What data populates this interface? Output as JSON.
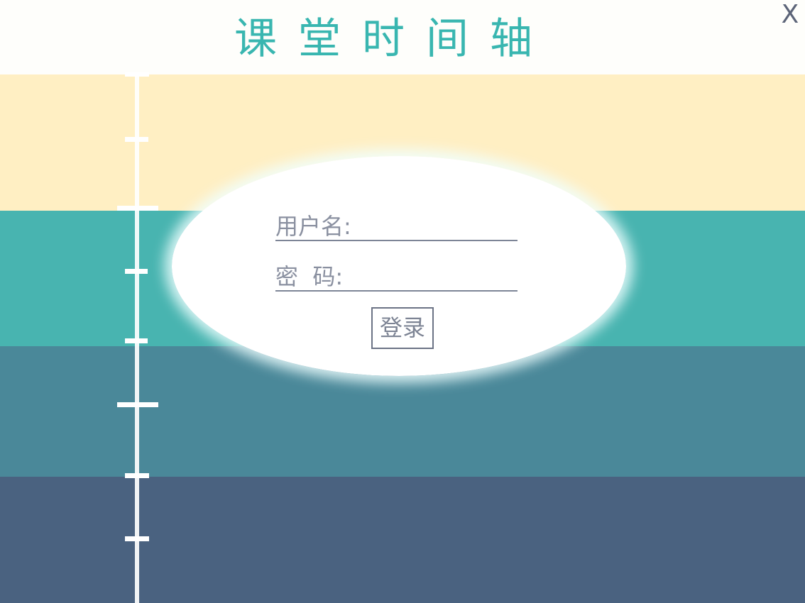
{
  "header": {
    "title": "课堂时间轴",
    "close_symbol": "X",
    "close_icon": "close-icon"
  },
  "colors": {
    "title": "#39b6b0",
    "close": "#5c6478",
    "header_bg": "#fefefb",
    "band_1": "#ffefc3",
    "band_2": "#48b4b0",
    "band_3": "#4a8899",
    "band_4": "#4a6280",
    "timeline": "#ffffff"
  },
  "login": {
    "username_label": "用户名:",
    "username_value": "",
    "password_label": "密  码:",
    "password_value": "",
    "submit_label": "登录"
  }
}
